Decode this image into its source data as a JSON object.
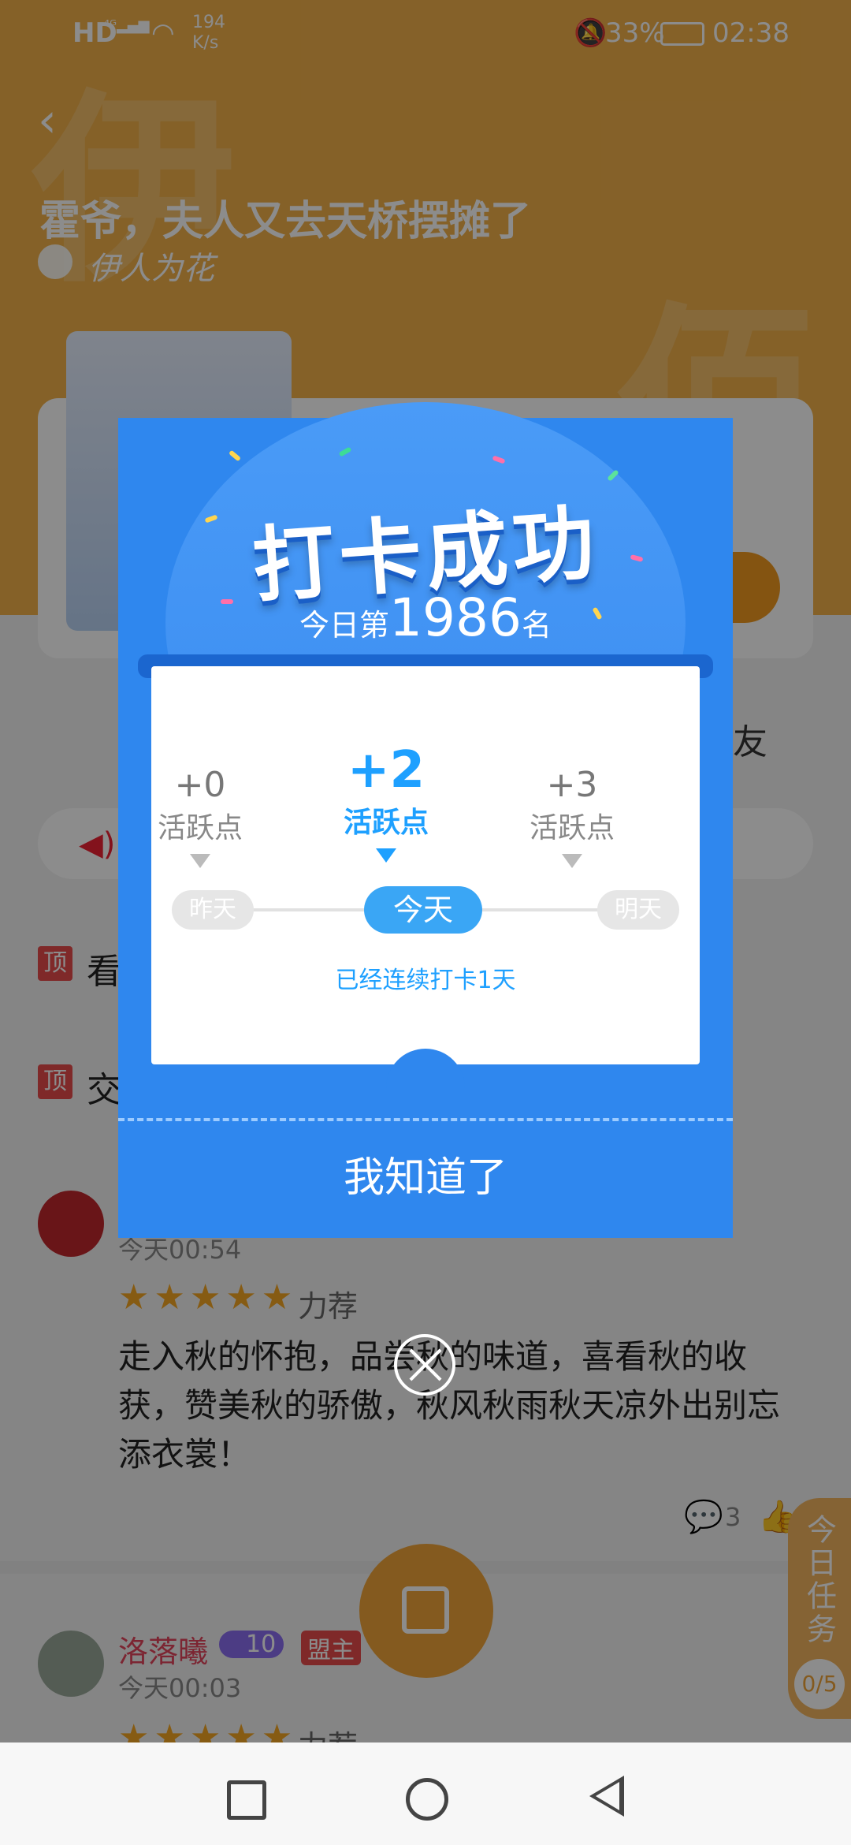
{
  "status_bar": {
    "network_rate": "194",
    "network_unit": "K/s",
    "battery": "33%",
    "time": "02:38"
  },
  "book": {
    "title": "霍爷，夫人又去天桥摆摊了",
    "author": "伊人为花"
  },
  "page": {
    "friend_tab": "友",
    "pinned_prefix": "顶",
    "pinned_1": "看",
    "pinned_2": "交"
  },
  "comments": [
    {
      "time": "今天00:54",
      "rating_label": "力荐",
      "text": "走入秋的怀抱，品尝秋的味道，喜看秋的收获，赞美秋的骄傲，秋风秋雨秋天凉外出别忘添衣裳！",
      "reply_count": "3"
    },
    {
      "user": "洛落曦",
      "level": "10",
      "badge": "盟主",
      "time": "今天00:03",
      "rating_label": "力荐"
    }
  ],
  "task_widget": {
    "label": "今日任务",
    "progress": "0/5"
  },
  "dialog": {
    "title": "打卡成功",
    "rank_prefix": "今日第",
    "rank_number": "1986",
    "rank_suffix": "名",
    "days": [
      {
        "points": "+0",
        "label": "活跃点",
        "day": "昨天"
      },
      {
        "points": "+2",
        "label": "活跃点",
        "day": "今天"
      },
      {
        "points": "+3",
        "label": "活跃点",
        "day": "明天"
      }
    ],
    "streak_text": "已经连续打卡1天",
    "confirm_button": "我知道了"
  },
  "colors": {
    "dialog_blue": "#2f87ee",
    "accent_blue": "#1ea0ff",
    "hero_orange": "#f2b14a"
  }
}
